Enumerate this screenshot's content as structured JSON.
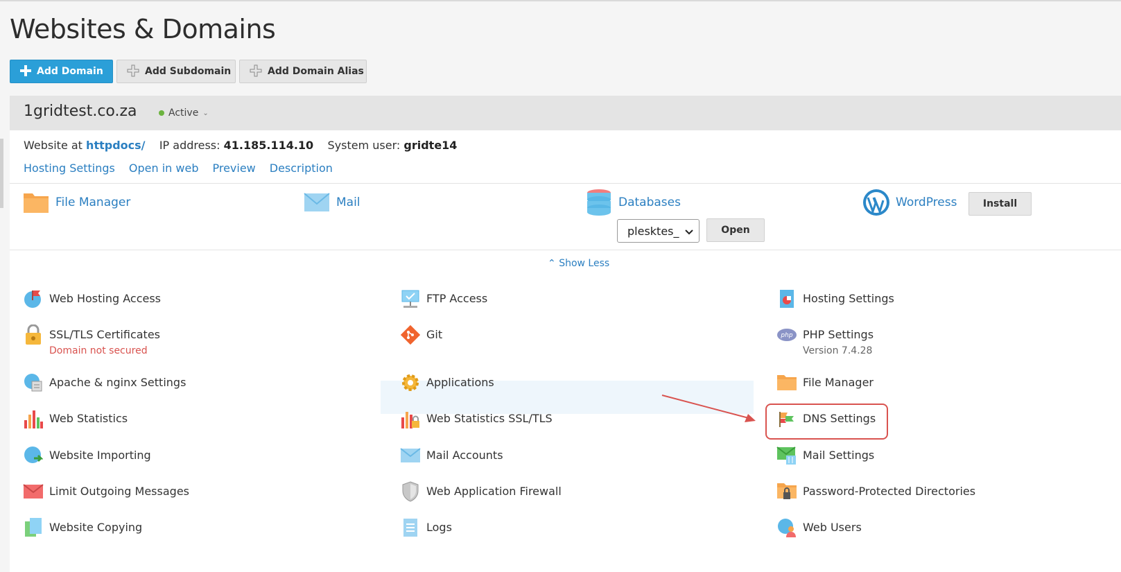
{
  "page": {
    "title": "Websites & Domains"
  },
  "toolbar": {
    "add_domain": "Add Domain",
    "add_subdomain": "Add Subdomain",
    "add_domain_alias": "Add Domain Alias"
  },
  "domain": {
    "name": "1gridtest.co.za",
    "status": "Active",
    "website_prefix": "Website at",
    "website_path": "httpdocs/",
    "ip_label": "IP address:",
    "ip_value": "41.185.114.10",
    "user_label": "System user:",
    "user_value": "gridte14",
    "links": [
      "Hosting Settings",
      "Open in web",
      "Preview",
      "Description"
    ]
  },
  "main_tools": {
    "file_manager": "File Manager",
    "mail": "Mail",
    "databases": "Databases",
    "db_select": "plesktes_",
    "open": "Open",
    "wordpress": "WordPress",
    "install": "Install"
  },
  "show_less": "Show Less",
  "grid": {
    "col1": [
      {
        "label": "Web Hosting Access",
        "icon": "globe-flag-icon"
      },
      {
        "label": "SSL/TLS Certificates",
        "sub": "Domain not secured",
        "icon": "lock-icon"
      },
      {
        "label": "Apache & nginx Settings",
        "icon": "globe-settings-icon"
      },
      {
        "label": "Web Statistics",
        "icon": "bar-chart-icon"
      },
      {
        "label": "Website Importing",
        "icon": "globe-import-icon"
      },
      {
        "label": "Limit Outgoing Messages",
        "icon": "envelope-limit-icon"
      },
      {
        "label": "Website Copying",
        "icon": "copy-icon"
      }
    ],
    "col2": [
      {
        "label": "FTP Access",
        "icon": "ftp-icon"
      },
      {
        "label": "Git",
        "icon": "git-icon"
      },
      {
        "label": "Applications",
        "icon": "gear-icon"
      },
      {
        "label": "Web Statistics SSL/TLS",
        "icon": "bar-chart-lock-icon"
      },
      {
        "label": "Mail Accounts",
        "icon": "envelope-icon"
      },
      {
        "label": "Web Application Firewall",
        "icon": "shield-icon"
      },
      {
        "label": "Logs",
        "icon": "document-icon"
      }
    ],
    "col3": [
      {
        "label": "Hosting Settings",
        "icon": "hosting-settings-icon"
      },
      {
        "label": "PHP Settings",
        "sub": "Version 7.4.28",
        "icon": "php-icon"
      },
      {
        "label": "File Manager",
        "icon": "folder-icon"
      },
      {
        "label": "DNS Settings",
        "icon": "dns-flag-icon"
      },
      {
        "label": "Mail Settings",
        "icon": "mail-settings-icon"
      },
      {
        "label": "Password-Protected Directories",
        "icon": "folder-lock-icon"
      },
      {
        "label": "Web Users",
        "icon": "globe-user-icon"
      }
    ]
  },
  "colors": {
    "accent": "#2b9fd8",
    "link": "#2b7fc1",
    "status_active": "#6cb33f",
    "error": "#d9534f"
  }
}
